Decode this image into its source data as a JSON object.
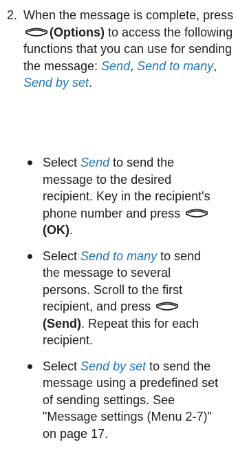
{
  "step": {
    "number": "2.",
    "intro_a": "When the message is complete, press",
    "options_label": "(Options)",
    "intro_b": "to access the following functions that you can use for sending the message:",
    "fn_send": "Send",
    "sep1": ", ",
    "fn_send_many": "Send to many",
    "sep2": ", ",
    "fn_send_set": "Send by set",
    "end": "."
  },
  "items": [
    {
      "select": "Select",
      "link": "Send",
      "text_a": "to send the message to the desired recipient. Key in the recipient's phone number and press",
      "key_label": "(OK)",
      "text_b": "."
    },
    {
      "select": "Select",
      "link": "Send to many",
      "text_a": "to send the message to several persons. Scroll to the first recipient, and press",
      "key_label": "(Send)",
      "text_b": ". Repeat this for each recipient."
    },
    {
      "select": "Select",
      "link": "Send by set",
      "text_a": "to send the message using a predefined set of sending settings. See \"Message settings (Menu 2-7)\" on page 17."
    }
  ],
  "icons": {
    "softkey": "selection-key-icon"
  },
  "colors": {
    "link": "#1b77c4",
    "text": "#1e1e1e"
  }
}
